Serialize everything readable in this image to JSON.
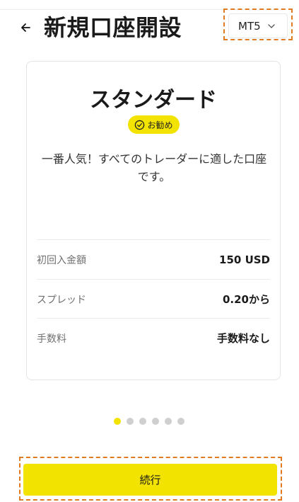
{
  "header": {
    "title": "新規口座開設",
    "platform_select": {
      "value": "MT5",
      "icon": "chevron-down-icon"
    },
    "back_icon": "arrow-left-icon"
  },
  "account_card": {
    "title": "スタンダード",
    "badge": {
      "label": "お勧め",
      "icon": "check-circle-icon",
      "color": "#f3e300"
    },
    "description_line1": "一番人気！すべてのトレーダーに適した口座",
    "description_line2": "です。",
    "specs": [
      {
        "label": "初回入金額",
        "value": "150 USD"
      },
      {
        "label": "スプレッド",
        "value": "0.20から"
      },
      {
        "label": "手数料",
        "value": "手数料なし"
      }
    ]
  },
  "pager": {
    "total": 6,
    "active_index": 0,
    "active_color": "#f3e300",
    "inactive_color": "#cfcfcf"
  },
  "footer": {
    "continue_label": "続行",
    "button_color": "#f3e300"
  },
  "highlight_color": "#e07b22"
}
